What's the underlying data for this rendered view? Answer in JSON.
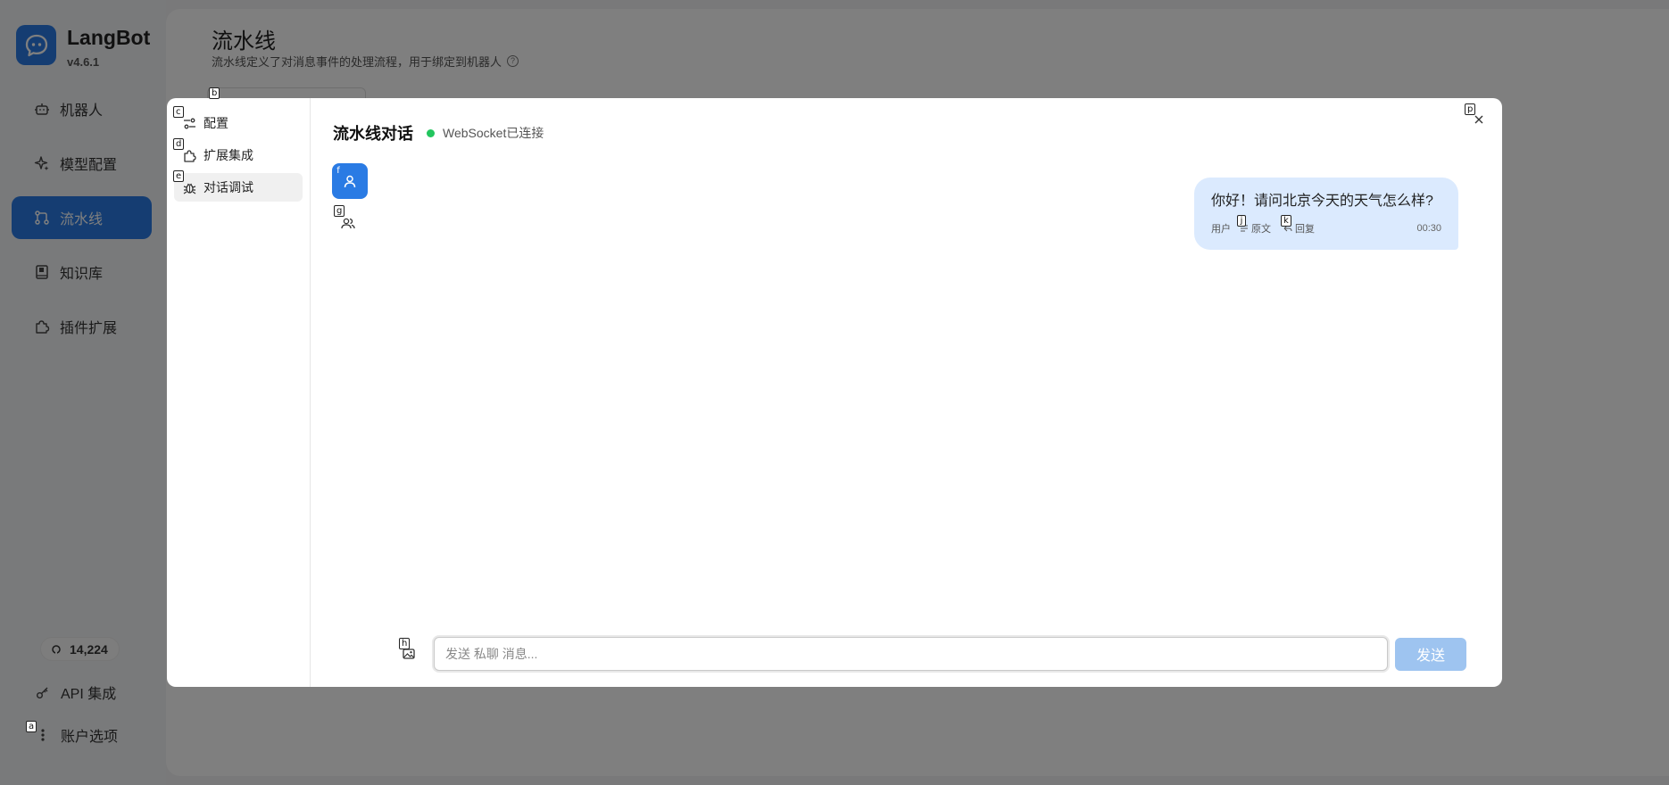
{
  "app": {
    "name": "LangBot",
    "version": "v4.6.1",
    "brand_color": "#2a7be4"
  },
  "sidebar": {
    "items": [
      {
        "label": "机器人",
        "icon": "bot-icon"
      },
      {
        "label": "模型配置",
        "icon": "sparkle-icon"
      },
      {
        "label": "流水线",
        "icon": "workflow-icon",
        "active": true
      },
      {
        "label": "知识库",
        "icon": "book-icon"
      },
      {
        "label": "插件扩展",
        "icon": "puzzle-icon"
      }
    ],
    "github_stars": "14,224",
    "api_label": "API 集成",
    "account_label": "账户选项"
  },
  "page": {
    "title": "流水线",
    "description": "流水线定义了对消息事件的处理流程，用于绑定到机器人",
    "help_glyph": "?"
  },
  "dialog": {
    "tabs": [
      {
        "label": "配置",
        "icon": "settings-icon",
        "hint": "c"
      },
      {
        "label": "扩展集成",
        "icon": "puzzle-icon",
        "hint": "d"
      },
      {
        "label": "对话调试",
        "icon": "bug-icon",
        "hint": "e",
        "active": true
      }
    ],
    "chat_title": "流水线对话",
    "ws_status": "WebSocket已连接",
    "ws_status_color": "#22c55e",
    "messages": [
      {
        "text": "你好！请问北京今天的天气怎么样?",
        "role": "用户",
        "raw_label": "原文",
        "reply_label": "回复",
        "time": "00:30"
      }
    ],
    "input_placeholder": "发送 私聊 消息...",
    "send_label": "发送"
  },
  "hints": {
    "a": "a",
    "b": "b",
    "c": "c",
    "d": "d",
    "e": "e",
    "f": "f",
    "g": "g",
    "h": "h",
    "j": "j",
    "k": "k",
    "p": "p"
  },
  "colors": {
    "accent": "#2a7be4",
    "bubble": "#dbeafe",
    "send_disabled": "#9ec4f0",
    "overlay": "rgba(0,0,0,0.5)"
  }
}
